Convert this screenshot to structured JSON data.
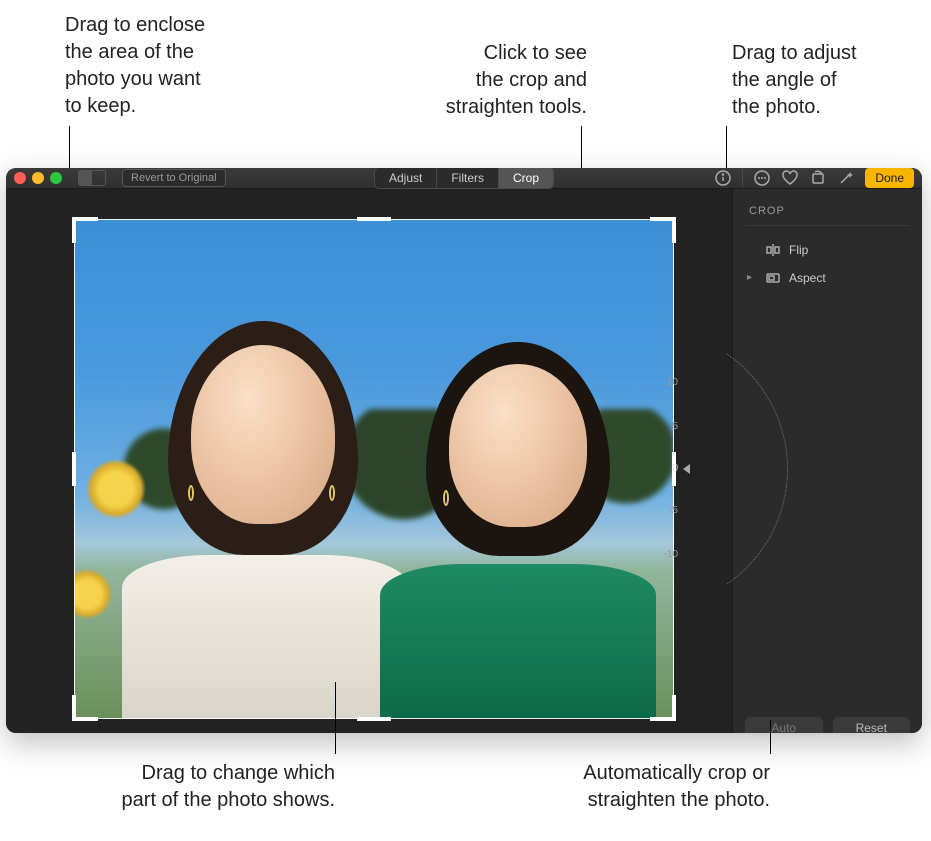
{
  "callouts": {
    "top_left": "Drag to enclose\nthe area of the\nphoto you want\nto keep.",
    "top_mid": "Click to see\nthe crop and\nstraighten tools.",
    "top_right": "Drag to adjust\nthe angle of\nthe photo.",
    "bottom_left": "Drag to change which\npart of the photo shows.",
    "bottom_right": "Automatically crop or\nstraighten the photo."
  },
  "toolbar": {
    "revert_label": "Revert to Original",
    "segments": {
      "adjust": "Adjust",
      "filters": "Filters",
      "crop": "Crop"
    },
    "done_label": "Done"
  },
  "angle_dial": {
    "ticks": [
      "10",
      "5",
      "0",
      "-5",
      "-10"
    ],
    "value": "0"
  },
  "inspector": {
    "title": "CROP",
    "flip_label": "Flip",
    "aspect_label": "Aspect",
    "auto_label": "Auto",
    "reset_label": "Reset"
  }
}
